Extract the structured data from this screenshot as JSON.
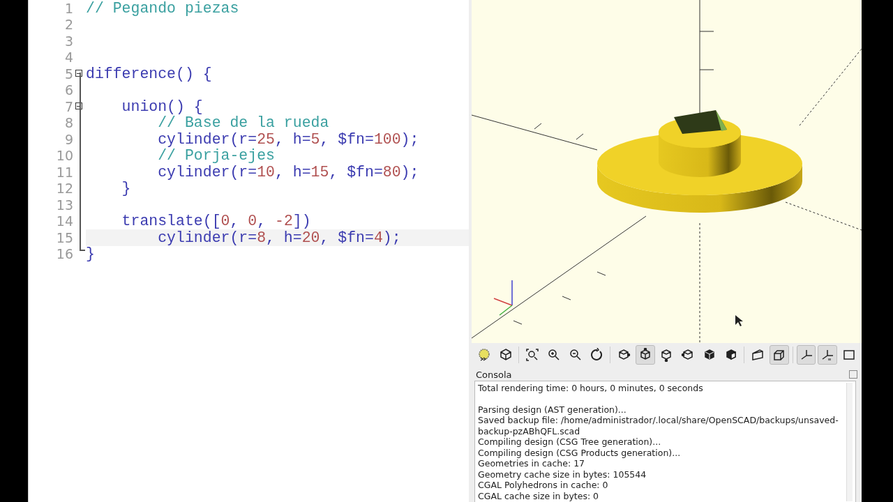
{
  "editor": {
    "lines": [
      {
        "number": "1",
        "fold": false,
        "current": false,
        "tokens": [
          {
            "t": "// Pegando piezas",
            "kind": "comment"
          }
        ]
      },
      {
        "number": "2",
        "fold": false,
        "current": false
      },
      {
        "number": "3",
        "fold": false,
        "current": false
      },
      {
        "number": "4",
        "fold": false,
        "current": false
      },
      {
        "number": "5",
        "fold": true,
        "current": false,
        "tokens": [
          {
            "t": "difference() {",
            "kind": "code"
          }
        ]
      },
      {
        "number": "6",
        "fold": false,
        "current": false
      },
      {
        "number": "7",
        "fold": true,
        "current": false,
        "tokens": [
          {
            "t": "    union() {",
            "kind": "code"
          }
        ]
      },
      {
        "number": "8",
        "fold": false,
        "current": false,
        "tokens": [
          {
            "t": "        // Base de la rueda",
            "kind": "comment"
          }
        ]
      },
      {
        "number": "9",
        "fold": false,
        "current": false,
        "tokens": [
          {
            "t": "        cylinder(r=",
            "kind": "code"
          },
          {
            "t": "25",
            "kind": "num"
          },
          {
            "t": ", h=",
            "kind": "code"
          },
          {
            "t": "5",
            "kind": "num"
          },
          {
            "t": ", $fn=",
            "kind": "code"
          },
          {
            "t": "100",
            "kind": "num"
          },
          {
            "t": ");",
            "kind": "code"
          }
        ]
      },
      {
        "number": "10",
        "fold": false,
        "current": false,
        "tokens": [
          {
            "t": "        // Porja-ejes",
            "kind": "comment"
          }
        ]
      },
      {
        "number": "11",
        "fold": false,
        "current": false,
        "tokens": [
          {
            "t": "        cylinder(r=",
            "kind": "code"
          },
          {
            "t": "10",
            "kind": "num"
          },
          {
            "t": ", h=",
            "kind": "code"
          },
          {
            "t": "15",
            "kind": "num"
          },
          {
            "t": ", $fn=",
            "kind": "code"
          },
          {
            "t": "80",
            "kind": "num"
          },
          {
            "t": ");",
            "kind": "code"
          }
        ]
      },
      {
        "number": "12",
        "fold": false,
        "current": false,
        "tokens": [
          {
            "t": "    }",
            "kind": "code"
          }
        ]
      },
      {
        "number": "13",
        "fold": false,
        "current": false
      },
      {
        "number": "14",
        "fold": false,
        "current": false,
        "tokens": [
          {
            "t": "    translate([",
            "kind": "code"
          },
          {
            "t": "0",
            "kind": "num"
          },
          {
            "t": ", ",
            "kind": "code"
          },
          {
            "t": "0",
            "kind": "num"
          },
          {
            "t": ", ",
            "kind": "code"
          },
          {
            "t": "-2",
            "kind": "num"
          },
          {
            "t": "])",
            "kind": "code"
          }
        ]
      },
      {
        "number": "15",
        "fold": false,
        "current": true,
        "tokens": [
          {
            "t": "        cylinder(r=",
            "kind": "code"
          },
          {
            "t": "8",
            "kind": "num"
          },
          {
            "t": ", h=",
            "kind": "code"
          },
          {
            "t": "20",
            "kind": "num"
          },
          {
            "t": ", $fn=",
            "kind": "code"
          },
          {
            "t": "4",
            "kind": "num"
          },
          {
            "t": ");",
            "kind": "code"
          }
        ]
      },
      {
        "number": "16",
        "fold": false,
        "current": false,
        "tokens": [
          {
            "t": "}",
            "kind": "code"
          }
        ]
      }
    ]
  },
  "toolbar": [
    {
      "kind": "preview",
      "selected": false,
      "separator_before": false
    },
    {
      "kind": "render",
      "selected": false,
      "separator_before": false
    },
    {
      "kind": "zoomall",
      "selected": false,
      "separator_before": true
    },
    {
      "kind": "zoomin",
      "selected": false,
      "separator_before": false
    },
    {
      "kind": "zoomout",
      "selected": false,
      "separator_before": false
    },
    {
      "kind": "reset",
      "selected": false,
      "separator_before": false
    },
    {
      "kind": "right",
      "selected": false,
      "separator_before": true
    },
    {
      "kind": "top",
      "selected": true,
      "separator_before": false
    },
    {
      "kind": "bottom",
      "selected": false,
      "separator_before": false
    },
    {
      "kind": "left",
      "selected": false,
      "separator_before": false
    },
    {
      "kind": "front",
      "selected": false,
      "separator_before": false
    },
    {
      "kind": "back",
      "selected": false,
      "separator_before": false
    },
    {
      "kind": "perspective",
      "selected": false,
      "separator_before": true
    },
    {
      "kind": "orthogonal",
      "selected": true,
      "separator_before": false
    },
    {
      "kind": "axes",
      "selected": true,
      "separator_before": true
    },
    {
      "kind": "scale",
      "selected": true,
      "separator_before": false
    },
    {
      "kind": "edges",
      "selected": false,
      "separator_before": false
    }
  ],
  "console": {
    "title": "Consola",
    "lines": [
      "Total rendering time: 0 hours, 0 minutes, 0 seconds",
      "Parsing design (AST generation)...",
      "Saved backup file: /home/administrador/.local/share/OpenSCAD/backups/unsaved-backup-pzABhQFL.scad",
      "Compiling design (CSG Tree generation)...",
      "Compiling design (CSG Products generation)...",
      "Geometries in cache: 17",
      "Geometry cache size in bytes: 105544",
      "CGAL Polyhedrons in cache: 0",
      "CGAL cache size in bytes: 0"
    ]
  }
}
